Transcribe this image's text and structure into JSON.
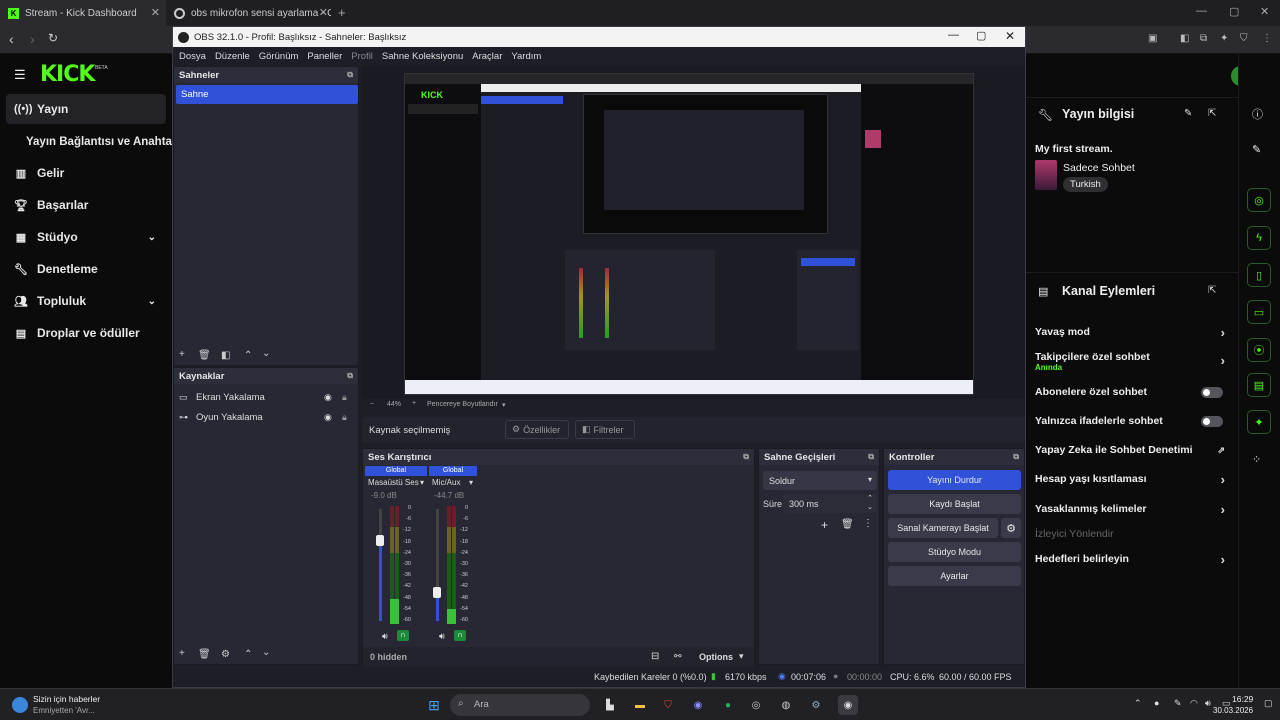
{
  "browser": {
    "tabs": [
      {
        "title": "Stream - Kick Dashboard",
        "icon": "kick-icon"
      },
      {
        "title": "obs mikrofon sensi ayarlama - Googl",
        "icon": "google-icon"
      }
    ],
    "new_tab": "+"
  },
  "kick": {
    "logo": "KICK",
    "logo_badge": "BETA",
    "nav": [
      {
        "label": "Yayın",
        "icon": "broadcast-icon",
        "active": true
      },
      {
        "label": "Yayın Bağlantısı ve Anahtarı",
        "icon": "",
        "active": false
      },
      {
        "label": "Gelir",
        "icon": "chart-icon",
        "active": false
      },
      {
        "label": "Başarılar",
        "icon": "trophy-icon",
        "active": false
      },
      {
        "label": "Stüdyo",
        "icon": "studio-icon",
        "active": false,
        "expandable": true
      },
      {
        "label": "Denetleme",
        "icon": "wrench-icon",
        "active": false
      },
      {
        "label": "Topluluk",
        "icon": "people-icon",
        "active": false,
        "expandable": true
      },
      {
        "label": "Droplar ve ödüller",
        "icon": "gift-icon",
        "active": false
      }
    ],
    "stream_info": {
      "title": "Yayın bilgisi",
      "stream_title": "My first stream.",
      "category": "Sadece Sohbet",
      "tag": "Turkish"
    },
    "channel_actions": {
      "title": "Kanal Eylemleri",
      "items": [
        {
          "label": "Yavaş mod",
          "type": "arrow"
        },
        {
          "label": "Takipçilere özel sohbet",
          "sub": "Anında",
          "type": "arrow"
        },
        {
          "label": "Abonelere özel sohbet",
          "type": "toggle"
        },
        {
          "label": "Yalnızca ifadelerle sohbet",
          "type": "toggle"
        },
        {
          "label": "Yapay Zeka ile Sohbet Denetimi",
          "type": "external"
        },
        {
          "label": "Hesap yaşı kısıtlaması",
          "type": "arrow"
        },
        {
          "label": "Yasaklanmış kelimeler",
          "type": "arrow"
        },
        {
          "label": "İzleyici Yönlendir",
          "type": "disabled"
        },
        {
          "label": "Hedefleri belirleyin",
          "type": "arrow"
        }
      ]
    }
  },
  "obs": {
    "title": "OBS 32.1.0 - Profil: Başlıksız - Sahneler: Başlıksız",
    "menu": [
      "Dosya",
      "Düzenle",
      "Görünüm",
      "Paneller",
      "Profil",
      "Sahne Koleksiyonu",
      "Araçlar",
      "Yardım"
    ],
    "scenes": {
      "title": "Sahneler",
      "items": [
        "Sahne"
      ]
    },
    "sources": {
      "title": "Kaynaklar",
      "items": [
        {
          "label": "Ekran Yakalama",
          "icon": "monitor-icon"
        },
        {
          "label": "Oyun Yakalama",
          "icon": "gamepad-icon"
        }
      ]
    },
    "zoom": {
      "value": "44%",
      "fit": "Pencereye Boyutlandır"
    },
    "source_bar": {
      "status": "Kaynak seçilmemiş",
      "properties": "Özellikler",
      "filters": "Filtreler"
    },
    "mixer": {
      "title": "Ses Karıştırıcı",
      "channels": [
        {
          "badge": "Global",
          "name": "Masaüstü Ses",
          "db": "-9.0 dB",
          "level": 0.72
        },
        {
          "badge": "Global",
          "name": "Mic/Aux",
          "db": "-44.7 dB",
          "level": 0.26
        }
      ],
      "scale": [
        "0",
        "-6",
        "-12",
        "-18",
        "-24",
        "-30",
        "-36",
        "-42",
        "-48",
        "-54",
        "-60"
      ],
      "hidden": "0 hidden",
      "options": "Options"
    },
    "transitions": {
      "title": "Sahne Geçişleri",
      "type": "Soldur",
      "duration_label": "Süre",
      "duration": "300 ms"
    },
    "controls": {
      "title": "Kontroller",
      "buttons": [
        "Yayını Durdur",
        "Kaydı Başlat",
        "Sanal Kamerayı Başlat",
        "Stüdyo Modu",
        "Ayarlar"
      ]
    },
    "status": {
      "dropped": "Kaybedilen Kareler 0 (%0.0)",
      "bitrate": "6170 kbps",
      "live_time": "00:07:06",
      "rec_time": "00:00:00",
      "cpu": "CPU: 6.6%",
      "fps": "60.00 / 60.00 FPS"
    }
  },
  "taskbar": {
    "news_title": "Sizin için haberler",
    "news_sub": "Emniyetten 'Avr...",
    "search": "Ara",
    "time": "16:29",
    "date": "30.03.2026"
  },
  "colors": {
    "kick_green": "#53fc18",
    "obs_bg": "#1d1e26",
    "obs_accent": "#2f52d8"
  }
}
